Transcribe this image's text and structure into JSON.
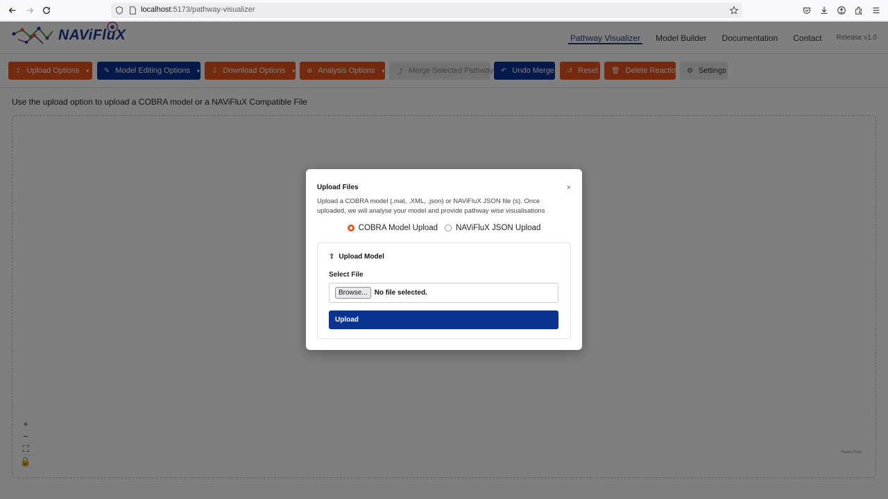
{
  "browser": {
    "url_host": "localhost",
    "url_path": ":5173/pathway-visualizer"
  },
  "header": {
    "logo_text": "NAViFluX",
    "nav": [
      "Pathway Visualizer",
      "Model Builder",
      "Documentation",
      "Contact"
    ],
    "active_nav": "Pathway Visualizer",
    "release": "Release v1.0"
  },
  "toolbar": {
    "upload_options": "Upload Options",
    "model_editing_options": "Model Editing Options",
    "download_options": "Download Options",
    "analysis_options": "Analysis Options",
    "merge_selected": "Merge Selected Pathways",
    "undo_merge": "Undo Merge",
    "reset": "Reset",
    "delete_reaction": "Delete Reaction",
    "settings": "Settings"
  },
  "main": {
    "info_text": "Use the upload option to upload a COBRA model or a NAViFluX Compatible File",
    "attribution": "React Flow"
  },
  "modal": {
    "title": "Upload Files",
    "close": "×",
    "description": "Upload a COBRA model (.mat, .XML, .json) or NAViFluX JSON file (s). Once uploaded, we will analyse your model and provide pathway wise visualisations",
    "radio_options": [
      "COBRA Model Upload",
      "NAViFluX JSON Upload"
    ],
    "selected_radio": "COBRA Model Upload",
    "card_title": "Upload Model",
    "field_label": "Select File",
    "browse_label": "Browse...",
    "file_status": "No file selected.",
    "upload_button": "Upload"
  },
  "colors": {
    "accent_orange": "#e8541c",
    "accent_navy": "#0a3394"
  }
}
